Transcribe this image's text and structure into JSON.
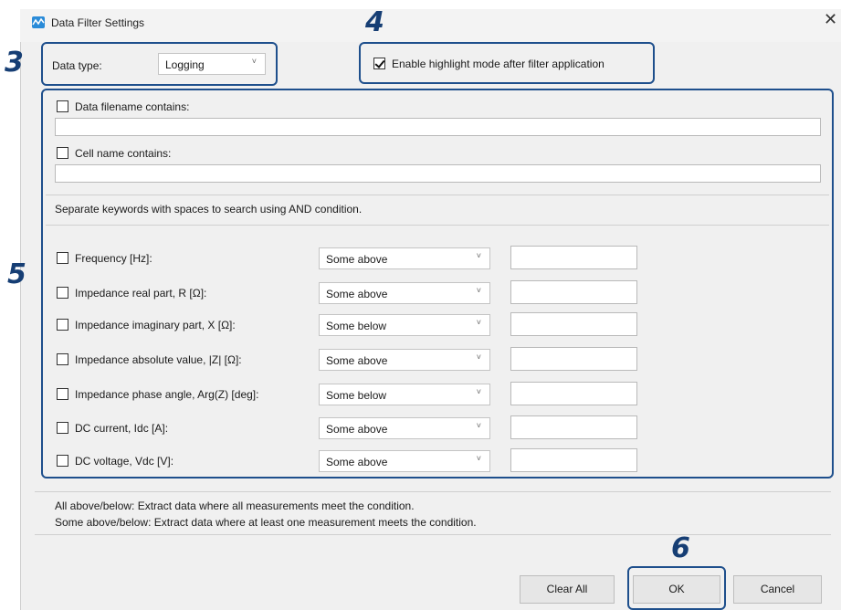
{
  "window": {
    "title": "Data Filter Settings",
    "close_glyph": "✕",
    "icon": "waveform-icon"
  },
  "steps": {
    "s3": "3",
    "s4": "4",
    "s5": "5",
    "s6": "6"
  },
  "data_type": {
    "label": "Data type:",
    "value": "Logging"
  },
  "highlight": {
    "label": "Enable highlight mode after filter application",
    "checked": true
  },
  "filename_filter": {
    "label": "Data filename contains:",
    "checked": false,
    "value": ""
  },
  "cellname_filter": {
    "label": "Cell name contains:",
    "checked": false,
    "value": ""
  },
  "hint": "Separate keywords with spaces to search using AND condition.",
  "conditions": [
    {
      "label": "Frequency [Hz]:",
      "mode": "Some above",
      "value": ""
    },
    {
      "label": "Impedance real part, R [Ω]:",
      "mode": "Some above",
      "value": ""
    },
    {
      "label": "Impedance imaginary part, X [Ω]:",
      "mode": "Some below",
      "value": ""
    },
    {
      "label": "Impedance absolute value, |Z| [Ω]:",
      "mode": "Some above",
      "value": ""
    },
    {
      "label": "Impedance phase angle, Arg(Z) [deg]:",
      "mode": "Some below",
      "value": ""
    },
    {
      "label": "DC current, Idc [A]:",
      "mode": "Some above",
      "value": ""
    },
    {
      "label": "DC voltage, Vdc [V]:",
      "mode": "Some above",
      "value": ""
    }
  ],
  "notes": {
    "all": "All above/below: Extract data where all measurements meet the condition.",
    "some": "Some above/below: Extract data where at least one measurement meets the condition."
  },
  "buttons": {
    "clear_all": "Clear All",
    "ok": "OK",
    "cancel": "Cancel"
  },
  "colors": {
    "callout": "#1e4f8c",
    "step_number": "#163e74",
    "accent": "#2a8bd8"
  }
}
